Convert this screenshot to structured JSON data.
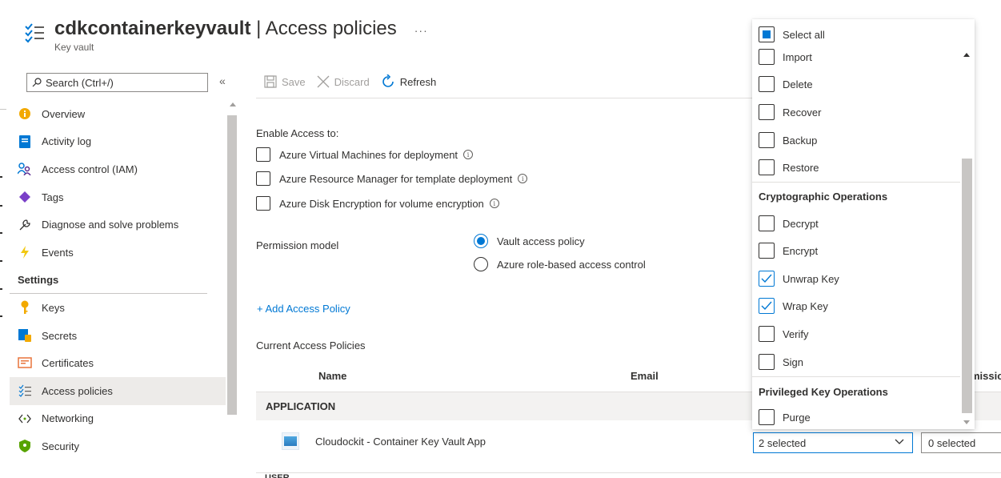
{
  "header": {
    "title_bold": "cdkcontainerkeyvault",
    "title_rest": " | Access policies",
    "more": "···",
    "subtitle": "Key vault"
  },
  "sidebar": {
    "search_placeholder": "Search (Ctrl+/)",
    "collapse": "«",
    "items": [
      {
        "label": "Overview",
        "icon": "overview-icon"
      },
      {
        "label": "Activity log",
        "icon": "activity-log-icon"
      },
      {
        "label": "Access control (IAM)",
        "icon": "iam-icon"
      },
      {
        "label": "Tags",
        "icon": "tag-icon"
      },
      {
        "label": "Diagnose and solve problems",
        "icon": "wrench-icon"
      },
      {
        "label": "Events",
        "icon": "lightning-icon"
      }
    ],
    "section_settings": "Settings",
    "settings_items": [
      {
        "label": "Keys",
        "icon": "key-icon"
      },
      {
        "label": "Secrets",
        "icon": "secret-icon"
      },
      {
        "label": "Certificates",
        "icon": "certificate-icon"
      },
      {
        "label": "Access policies",
        "icon": "access-policies-icon",
        "active": true
      },
      {
        "label": "Networking",
        "icon": "networking-icon"
      },
      {
        "label": "Security",
        "icon": "shield-icon"
      }
    ]
  },
  "toolbar": {
    "save": "Save",
    "discard": "Discard",
    "refresh": "Refresh"
  },
  "main": {
    "enable_access_label": "Enable Access to:",
    "enable_options": [
      "Azure Virtual Machines for deployment",
      "Azure Resource Manager for template deployment",
      "Azure Disk Encryption for volume encryption"
    ],
    "permission_model_label": "Permission model",
    "permission_options": [
      {
        "label": "Vault access policy",
        "selected": true
      },
      {
        "label": "Azure role-based access control",
        "selected": false
      }
    ],
    "add_policy": "+ Add Access Policy",
    "current_policies_label": "Current Access Policies",
    "columns": {
      "name": "Name",
      "email": "Email",
      "permissions_clip": "missio"
    },
    "group_application": "APPLICATION",
    "group_user_clip": "USER",
    "app_name": "Cloudockit - Container Key Vault App",
    "key_permissions_value": "2 selected",
    "secret_permissions_value": "0 selected"
  },
  "dropdown": {
    "select_all": "Select all",
    "items_a": [
      {
        "label": "Import",
        "checked": false
      },
      {
        "label": "Delete",
        "checked": false
      },
      {
        "label": "Recover",
        "checked": false
      },
      {
        "label": "Backup",
        "checked": false
      },
      {
        "label": "Restore",
        "checked": false
      }
    ],
    "section_crypto": "Cryptographic Operations",
    "items_b": [
      {
        "label": "Decrypt",
        "checked": false
      },
      {
        "label": "Encrypt",
        "checked": false
      },
      {
        "label": "Unwrap Key",
        "checked": true
      },
      {
        "label": "Wrap Key",
        "checked": true
      },
      {
        "label": "Verify",
        "checked": false
      },
      {
        "label": "Sign",
        "checked": false
      }
    ],
    "section_privileged": "Privileged Key Operations",
    "items_c": [
      {
        "label": "Purge",
        "checked": false
      }
    ]
  },
  "colors": {
    "accent": "#0078d4",
    "active_nav": "#edebe9"
  }
}
